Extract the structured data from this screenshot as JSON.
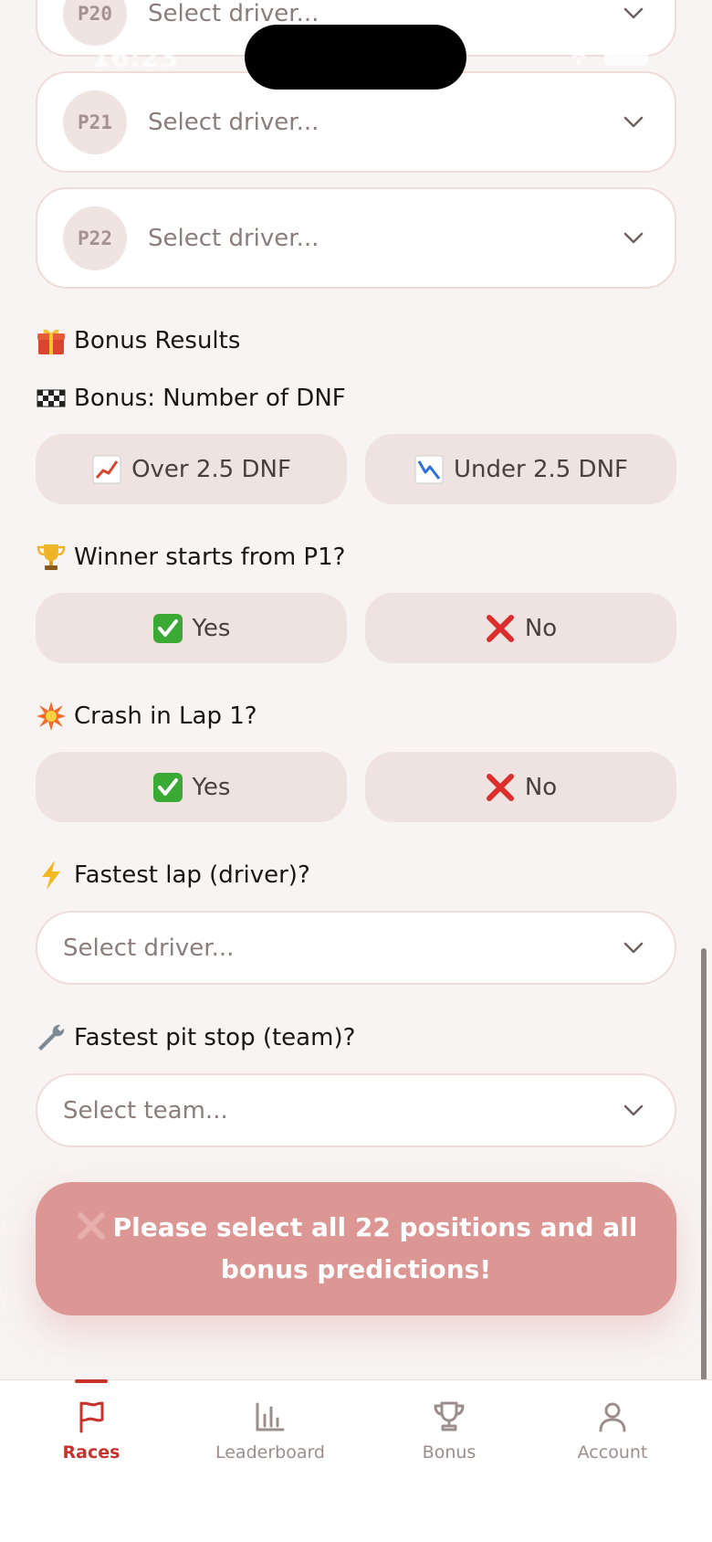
{
  "status_bar": {
    "time": "16:23"
  },
  "positions": [
    {
      "label": "P20",
      "placeholder": "Select driver..."
    },
    {
      "label": "P21",
      "placeholder": "Select driver..."
    },
    {
      "label": "P22",
      "placeholder": "Select driver..."
    }
  ],
  "bonus": {
    "heading": "Bonus Results",
    "dnf": {
      "title": "Bonus: Number of DNF",
      "over": "Over 2.5 DNF",
      "under": "Under 2.5 DNF"
    },
    "winner_p1": {
      "title": "Winner starts from P1?",
      "yes": "Yes",
      "no": "No"
    },
    "crash_lap1": {
      "title": "Crash in Lap 1?",
      "yes": "Yes",
      "no": "No"
    },
    "fastest_lap": {
      "title": "Fastest lap (driver)?",
      "placeholder": "Select driver..."
    },
    "fastest_pit": {
      "title": "Fastest pit stop (team)?",
      "placeholder": "Select team..."
    }
  },
  "submit": {
    "message": "Please select all 22 positions and all bonus predictions!"
  },
  "tabs": [
    {
      "label": "Races",
      "icon": "flag-icon",
      "active": true
    },
    {
      "label": "Leaderboard",
      "icon": "bar-chart-icon",
      "active": false
    },
    {
      "label": "Bonus",
      "icon": "trophy-icon",
      "active": false
    },
    {
      "label": "Account",
      "icon": "person-icon",
      "active": false
    }
  ],
  "colors": {
    "accent": "#c8322c",
    "background": "#f7f4f3",
    "option_bg": "#efe3e1",
    "error_banner": "#dc9693"
  }
}
